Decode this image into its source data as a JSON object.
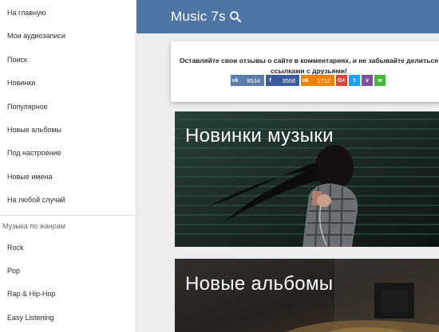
{
  "sidebar": {
    "items": [
      {
        "label": "На главную"
      },
      {
        "label": "Мои аудиозаписи"
      },
      {
        "label": "Поиск"
      },
      {
        "label": "Новинки"
      },
      {
        "label": "Популярное"
      },
      {
        "label": "Новые альбомы"
      },
      {
        "label": "Под настроение"
      },
      {
        "label": "Новые имена"
      },
      {
        "label": "На любой случай"
      }
    ],
    "genres_heading": "Музыка по жанрам",
    "genres": [
      {
        "label": "Rock"
      },
      {
        "label": "Pop"
      },
      {
        "label": "Rap & Hip-Hop"
      },
      {
        "label": "Easy Listening"
      }
    ]
  },
  "header": {
    "logo": "Music 7s",
    "search_icon": "search-icon"
  },
  "share": {
    "text": "Оставляйте свои отзывы о сайте в комментариях, и не забывайте делиться ссылками с друзьями!",
    "vk_count": "8534",
    "fb_count": "3508",
    "ok_count": "1712",
    "vk_glyph": "vk",
    "fb_glyph": "f",
    "ok_glyph": "ok",
    "gp_glyph": "G+",
    "tw_glyph": "t",
    "vb_glyph": "v",
    "wa_glyph": "w"
  },
  "banners": [
    {
      "title": "Новинки музыки"
    },
    {
      "title": "Новые альбомы"
    }
  ],
  "colors": {
    "header": "#4e75a4",
    "vk": "#5a7ea8",
    "facebook": "#3b5b9c",
    "odnoklassniki": "#ee8208",
    "google_plus": "#db4437",
    "twitter": "#1da1f2",
    "viber": "#7b519d",
    "whatsapp": "#4ab73f"
  }
}
